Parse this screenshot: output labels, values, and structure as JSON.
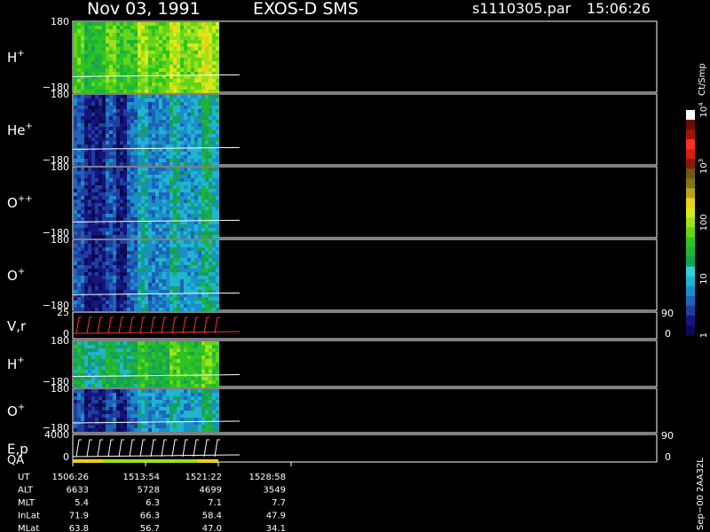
{
  "header": {
    "date": "Nov 03, 1991",
    "instrument": "EXOS-D SMS",
    "file": "s1110305.par",
    "time": "15:06:26"
  },
  "colorbar": {
    "unit": "Ct/Smp",
    "tick_labels": [
      {
        "label": "1",
        "value": 1
      },
      {
        "label": "10",
        "value": 10
      },
      {
        "label": "100",
        "value": 100
      },
      {
        "label": "10",
        "sup": "3",
        "value": 1000
      },
      {
        "label": "10",
        "sup": "4",
        "value": 10000
      }
    ],
    "colors": [
      "#0b0b50",
      "#15157e",
      "#1f3ea0",
      "#1d65b8",
      "#1a8fc8",
      "#1fb4cf",
      "#2fd3d6",
      "#15a05b",
      "#1fb33a",
      "#2ec421",
      "#63d41a",
      "#9fe018",
      "#d6ea1a",
      "#e9d21a",
      "#b8a416",
      "#7d7815",
      "#6b5a10",
      "#8a1a0a",
      "#d42010",
      "#ff3020",
      "#a01408",
      "#6a0c06",
      "#ffffff"
    ]
  },
  "panels": [
    {
      "label": "H",
      "sup": "+",
      "ymax": "180",
      "ymin": "−180",
      "type": "spectrogram",
      "palette": "bright"
    },
    {
      "label": "He",
      "sup": "+",
      "ymax": "180",
      "ymin": "−180",
      "type": "spectrogram",
      "palette": "blue"
    },
    {
      "label": "O",
      "sup": "++",
      "ymax": "180",
      "ymin": "−180",
      "type": "spectrogram",
      "palette": "blue"
    },
    {
      "label": "O",
      "sup": "+",
      "ymax": "180",
      "ymin": "−180",
      "type": "spectrogram",
      "palette": "blue"
    },
    {
      "label": "V,r",
      "sup": "",
      "ymax": "25",
      "ymin": "0",
      "right_top": "90",
      "right_bottom": "0",
      "type": "trace",
      "color": "#ff3030"
    },
    {
      "label": "H",
      "sup": "+",
      "ymax": "180",
      "ymin": "−180",
      "type": "spectrogram",
      "palette": "mid"
    },
    {
      "label": "O",
      "sup": "+",
      "ymax": "180",
      "ymin": "−180",
      "type": "spectrogram",
      "palette": "blue"
    },
    {
      "label": "E,p",
      "sup": "",
      "ymax": "4000",
      "ymin": "0",
      "right_top": "90",
      "right_bottom": "0",
      "type": "trace",
      "color": "#ffffff",
      "sublabel": "QA"
    }
  ],
  "ephemeris": {
    "rows": [
      {
        "name": "UT",
        "values": [
          "1506:26",
          "1513:54",
          "1521:22",
          "1528:58"
        ]
      },
      {
        "name": "ALT",
        "values": [
          "6633",
          "5728",
          "4699",
          "3549"
        ]
      },
      {
        "name": "MLT",
        "values": [
          "5.4",
          "6.3",
          "7.1",
          "7.7"
        ]
      },
      {
        "name": "InLat",
        "values": [
          "71.9",
          "66.3",
          "58.4",
          "47.9"
        ]
      },
      {
        "name": "MLat",
        "values": [
          "63.8",
          "56.7",
          "47.0",
          "34.1"
        ]
      }
    ]
  },
  "footer_label": "Sep−00 2AA32L",
  "chart_data": {
    "type": "heatmap",
    "title": "Nov 03, 1991   EXOS-D SMS",
    "subtitle": "s1110305.par  15:06:26",
    "x_ticks_ut": [
      "1506:26",
      "1513:54",
      "1521:22",
      "1528:58"
    ],
    "data_extent_ut": [
      "1506:26",
      "1521:22"
    ],
    "series": [
      {
        "name": "H+",
        "y_range": [
          -180,
          180
        ]
      },
      {
        "name": "He+",
        "y_range": [
          -180,
          180
        ]
      },
      {
        "name": "O++",
        "y_range": [
          -180,
          180
        ]
      },
      {
        "name": "O+",
        "y_range": [
          -180,
          180
        ]
      },
      {
        "name": "V,r",
        "y_range": [
          0,
          25
        ],
        "right_range": [
          0,
          90
        ]
      },
      {
        "name": "H+",
        "y_range": [
          -180,
          180
        ]
      },
      {
        "name": "O+",
        "y_range": [
          -180,
          180
        ]
      },
      {
        "name": "E,p",
        "y_range": [
          0,
          4000
        ],
        "right_range": [
          0,
          90
        ]
      }
    ],
    "colorbar_unit": "Ct/Smp",
    "colorbar_scale": "log",
    "colorbar_range": [
      1,
      10000
    ]
  }
}
